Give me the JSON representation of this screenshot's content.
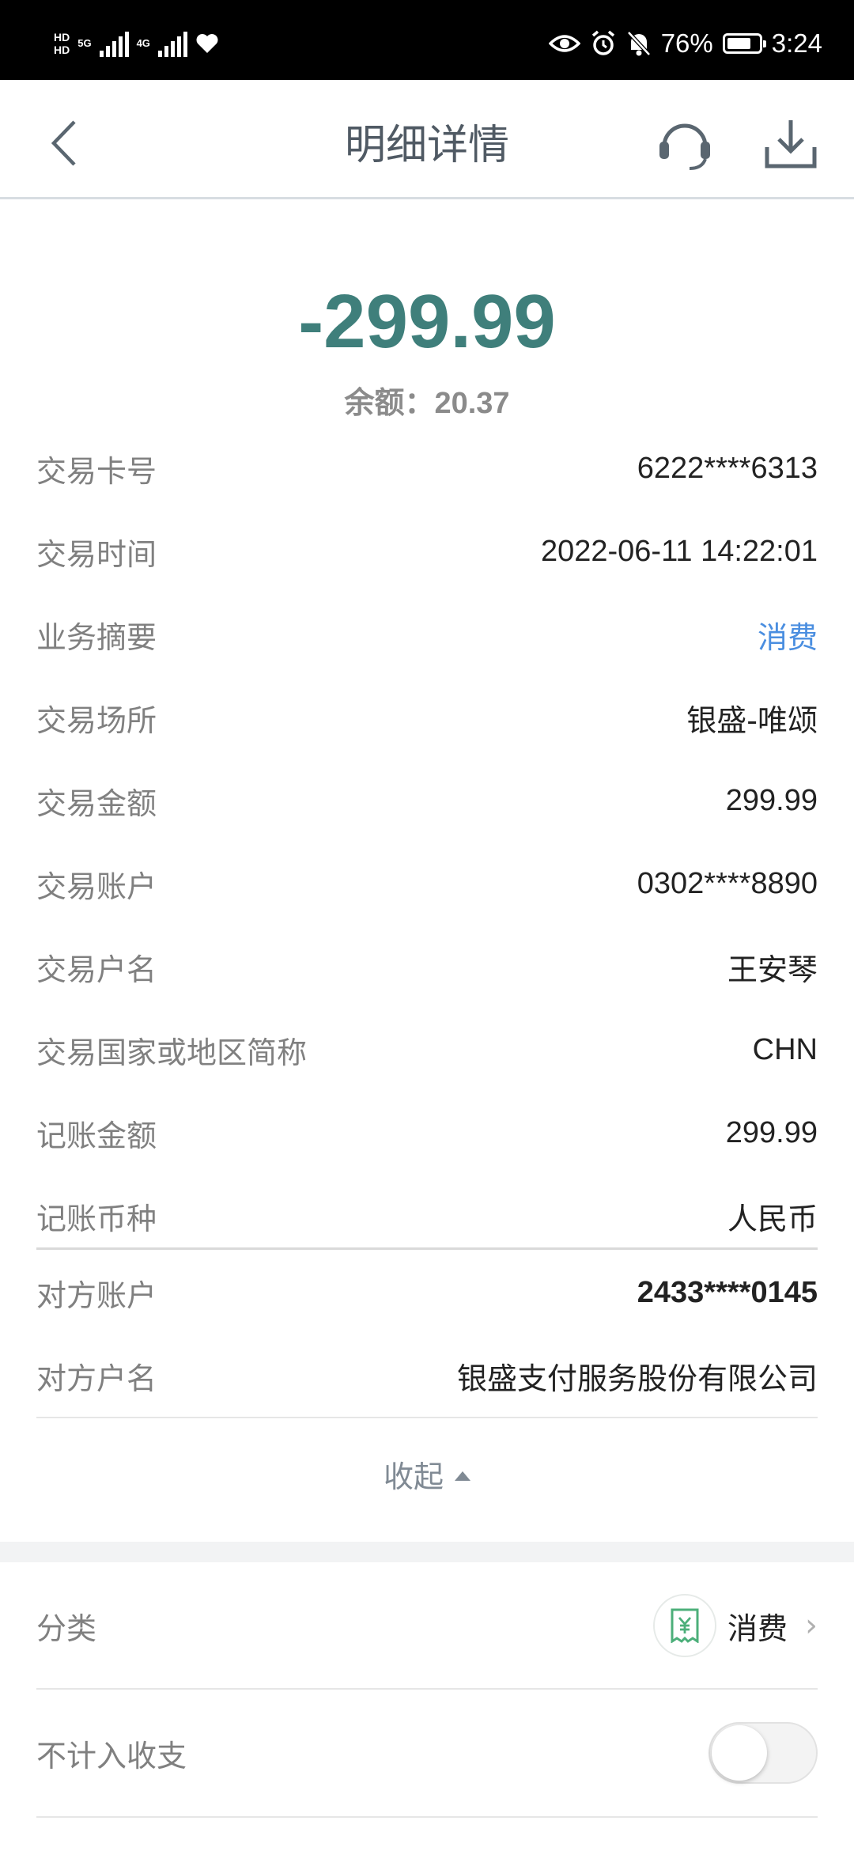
{
  "status_bar": {
    "hd1": "HD",
    "hd2": "HD",
    "net1": "5G",
    "net2": "4G",
    "battery_percent": "76%",
    "battery_level": 0.76,
    "time": "3:24"
  },
  "header": {
    "title": "明细详情",
    "back_icon": "chevron-left-icon",
    "service_icon": "headset-icon",
    "download_icon": "download-icon"
  },
  "summary": {
    "amount": "-299.99",
    "balance": "余额：20.37"
  },
  "details": [
    {
      "label": "交易卡号",
      "value": "6222****6313"
    },
    {
      "label": "交易时间",
      "value": "2022-06-11 14:22:01"
    },
    {
      "label": "业务摘要",
      "value": "消费"
    },
    {
      "label": "交易场所",
      "value": "银盛-唯颂"
    },
    {
      "label": "交易金额",
      "value": "299.99"
    },
    {
      "label": "交易账户",
      "value": "0302****8890"
    },
    {
      "label": "交易户名",
      "value": "王安琴"
    },
    {
      "label": "交易国家或地区简称",
      "value": "CHN"
    },
    {
      "label": "记账金额",
      "value": "299.99"
    },
    {
      "label": "记账币种",
      "value": "人民币"
    }
  ],
  "counterparty": [
    {
      "label": "对方账户",
      "value": "2433****0145"
    },
    {
      "label": "对方户名",
      "value": "银盛支付服务股份有限公司"
    }
  ],
  "collapse_label": "收起",
  "settings": {
    "category_label": "分类",
    "category_value": "消费",
    "category_icon": "yuan-receipt-icon",
    "exclude_label": "不计入收支",
    "exclude_on": false
  },
  "colors": {
    "amount": "#3f7f7b",
    "link": "#4a8ee0",
    "category_icon": "#4caf7a"
  }
}
